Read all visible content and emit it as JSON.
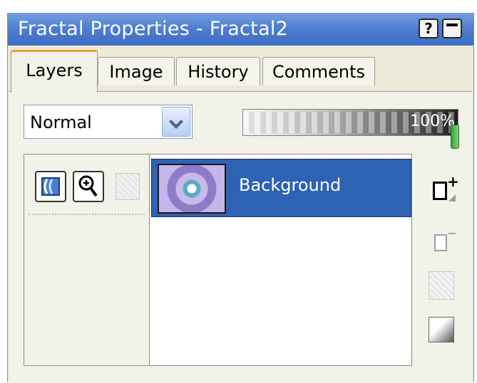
{
  "window": {
    "title": "Fractal Properties - Fractal2",
    "help_label": "?"
  },
  "tabs": [
    {
      "label": "Layers",
      "active": true
    },
    {
      "label": "Image",
      "active": false
    },
    {
      "label": "History",
      "active": false
    },
    {
      "label": "Comments",
      "active": false
    }
  ],
  "layers_panel": {
    "blend_mode": "Normal",
    "opacity_label": "100%",
    "opacity_value": 1.0,
    "layers": [
      {
        "name": "Background",
        "selected": true
      }
    ]
  },
  "icons": {
    "visibility": "layer-visibility-icon",
    "zoom": "zoom-icon",
    "mask": "layer-mask-icon",
    "new_layer": "new-layer-icon",
    "delete_layer": "delete-layer-icon",
    "duplicate_layer": "duplicate-layer-icon",
    "gradient": "gradient-icon"
  },
  "colors": {
    "titlebar": "#4f7fd2",
    "selection": "#2e62b4",
    "tab_accent": "#f0a030"
  }
}
